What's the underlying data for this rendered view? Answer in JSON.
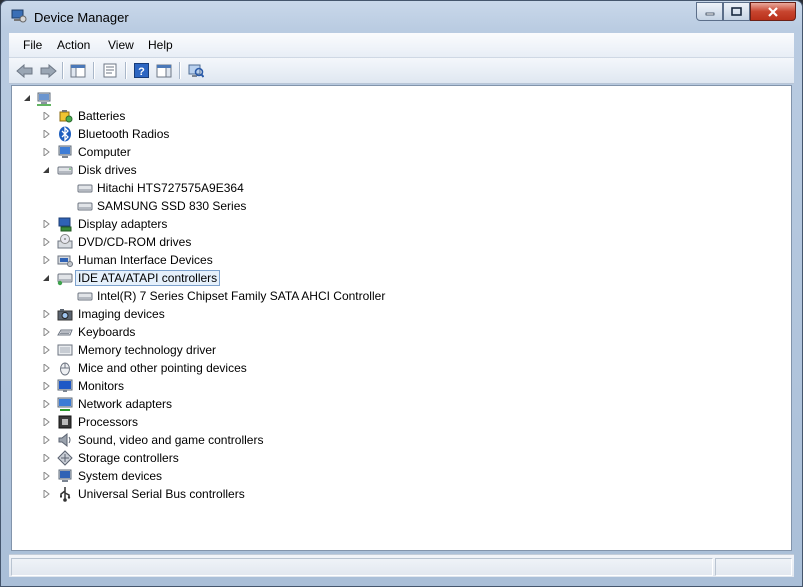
{
  "window": {
    "title": "Device Manager"
  },
  "menu": [
    "File",
    "Action",
    "View",
    "Help"
  ],
  "toolbar": {
    "buttons": [
      "back-icon",
      "forward-icon",
      "show-hide-console-tree-icon",
      "properties-icon",
      "help-icon",
      "show-hide-action-pane-icon",
      "scan-hardware-changes-icon"
    ]
  },
  "tree": {
    "root_label": "",
    "categories": [
      {
        "label": "Batteries",
        "expanded": false,
        "icon": "battery-icon",
        "children": []
      },
      {
        "label": "Bluetooth Radios",
        "expanded": false,
        "icon": "bluetooth-icon",
        "children": []
      },
      {
        "label": "Computer",
        "expanded": false,
        "icon": "computer-icon",
        "children": []
      },
      {
        "label": "Disk drives",
        "expanded": true,
        "icon": "disk-drive-icon",
        "children": [
          "Hitachi HTS727575A9E364",
          "SAMSUNG SSD 830 Series"
        ]
      },
      {
        "label": "Display adapters",
        "expanded": false,
        "icon": "display-adapter-icon",
        "children": []
      },
      {
        "label": "DVD/CD-ROM drives",
        "expanded": false,
        "icon": "dvd-drive-icon",
        "children": []
      },
      {
        "label": "Human Interface Devices",
        "expanded": false,
        "icon": "hid-icon",
        "children": []
      },
      {
        "label": "IDE ATA/ATAPI controllers",
        "expanded": true,
        "selected": true,
        "icon": "ide-controller-icon",
        "children": [
          "Intel(R) 7 Series Chipset Family SATA AHCI Controller"
        ]
      },
      {
        "label": "Imaging devices",
        "expanded": false,
        "icon": "camera-icon",
        "children": []
      },
      {
        "label": "Keyboards",
        "expanded": false,
        "icon": "keyboard-icon",
        "children": []
      },
      {
        "label": "Memory technology driver",
        "expanded": false,
        "icon": "memory-icon",
        "children": []
      },
      {
        "label": "Mice and other pointing devices",
        "expanded": false,
        "icon": "mouse-icon",
        "children": []
      },
      {
        "label": "Monitors",
        "expanded": false,
        "icon": "monitor-icon",
        "children": []
      },
      {
        "label": "Network adapters",
        "expanded": false,
        "icon": "network-adapter-icon",
        "children": []
      },
      {
        "label": "Processors",
        "expanded": false,
        "icon": "processor-icon",
        "children": []
      },
      {
        "label": "Sound, video and game controllers",
        "expanded": false,
        "icon": "speaker-icon",
        "children": []
      },
      {
        "label": "Storage controllers",
        "expanded": false,
        "icon": "storage-controller-icon",
        "children": []
      },
      {
        "label": "System devices",
        "expanded": false,
        "icon": "system-device-icon",
        "children": []
      },
      {
        "label": "Universal Serial Bus controllers",
        "expanded": false,
        "icon": "usb-icon",
        "children": []
      }
    ]
  },
  "colors": {
    "selection_border": "#7da2ce",
    "selection_fill": "#e5f0fb",
    "frame": "#b9cbe1",
    "close_button": "#c8452f"
  }
}
